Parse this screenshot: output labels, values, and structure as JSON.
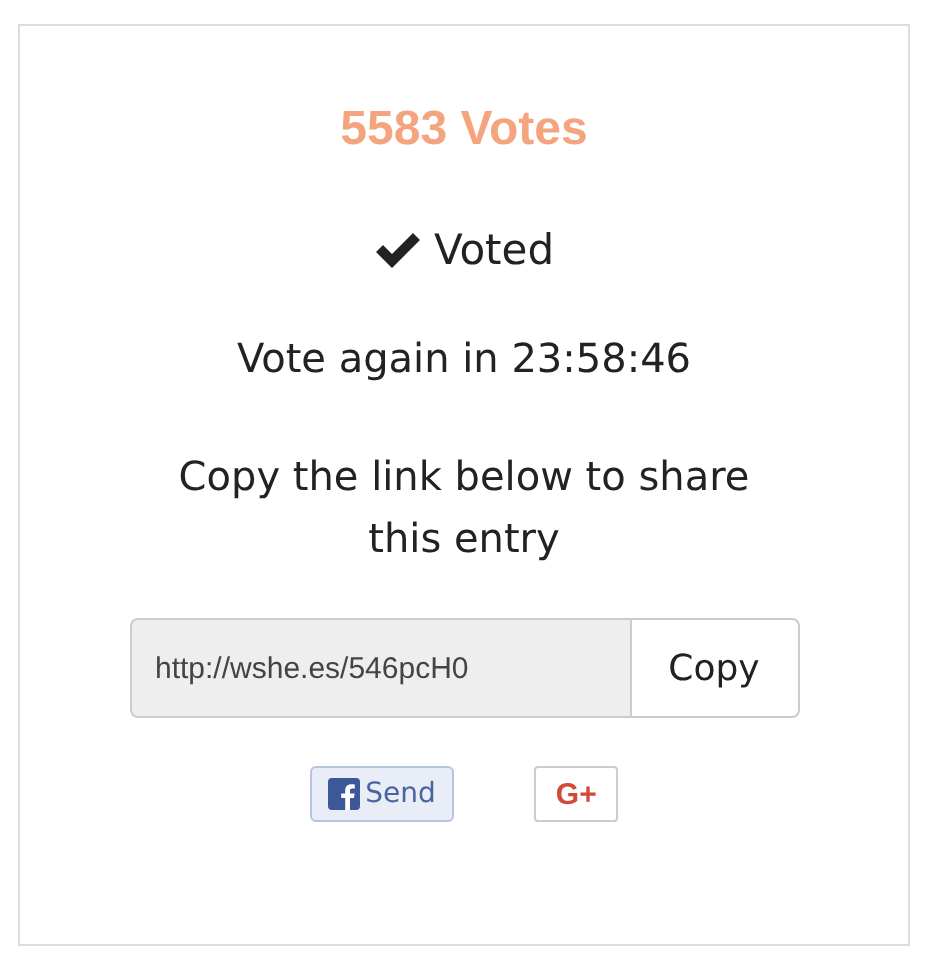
{
  "votes": "5583 Votes",
  "status": {
    "label": "Voted",
    "voted": true
  },
  "countdown": "Vote again in 23:58:46",
  "share_prompt": "Copy the link below to share this entry",
  "link_field": {
    "value": "http://wshe.es/546pcH0"
  },
  "copy_button": "Copy",
  "social_buttons": [
    {
      "kind": "facebook",
      "label": "Send"
    },
    {
      "kind": "googleplus",
      "label": "G+"
    }
  ]
}
